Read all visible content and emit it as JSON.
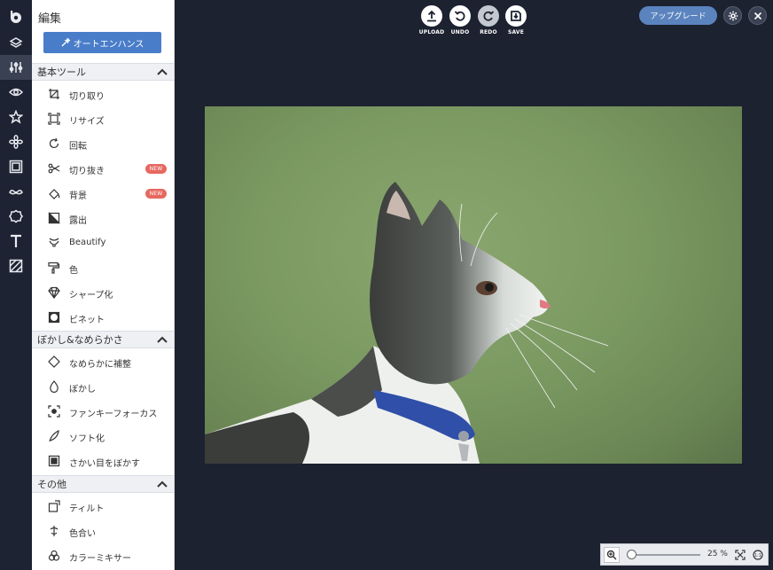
{
  "rail": {
    "items": [
      "logo",
      "layers",
      "adjust",
      "eye",
      "star",
      "flower",
      "frame",
      "mustache",
      "shape",
      "text",
      "texture"
    ]
  },
  "panel": {
    "title": "編集",
    "auto_enhance_label": "オートエンハンス",
    "sections": [
      {
        "title": "基本ツール",
        "tools": [
          {
            "label": "切り取り",
            "icon": "crop-icon"
          },
          {
            "label": "リサイズ",
            "icon": "resize-icon"
          },
          {
            "label": "回転",
            "icon": "rotate-icon"
          },
          {
            "label": "切り抜き",
            "icon": "cutout-icon",
            "badge": "NEW"
          },
          {
            "label": "背景",
            "icon": "background-icon",
            "badge": "NEW"
          },
          {
            "label": "露出",
            "icon": "exposure-icon"
          },
          {
            "label": "Beautify",
            "icon": "beautify-icon"
          },
          {
            "label": "色",
            "icon": "color-icon"
          },
          {
            "label": "シャープ化",
            "icon": "sharpen-icon"
          },
          {
            "label": "ビネット",
            "icon": "vignette-icon"
          }
        ]
      },
      {
        "title": "ぼかし&なめらかさ",
        "tools": [
          {
            "label": "なめらかに補整",
            "icon": "smooth-icon"
          },
          {
            "label": "ぼかし",
            "icon": "blur-icon"
          },
          {
            "label": "ファンキーフォーカス",
            "icon": "funky-focus-icon"
          },
          {
            "label": "ソフト化",
            "icon": "soften-icon"
          },
          {
            "label": "さかい目をぼかす",
            "icon": "blur-edges-icon"
          }
        ]
      },
      {
        "title": "その他",
        "tools": [
          {
            "label": "ティルト",
            "icon": "tilt-icon"
          },
          {
            "label": "色合い",
            "icon": "tint-icon"
          },
          {
            "label": "カラーミキサー",
            "icon": "color-mixer-icon"
          }
        ]
      }
    ]
  },
  "toolbar": {
    "upload": "UPLOAD",
    "undo": "UNDO",
    "redo": "REDO",
    "save": "SAVE",
    "upgrade": "アップグレード"
  },
  "zoom": {
    "value": "25 %",
    "level": 0.25
  },
  "colors": {
    "background": "#1c2230",
    "accent": "#4a7dc9",
    "badge": "#e6685f"
  }
}
